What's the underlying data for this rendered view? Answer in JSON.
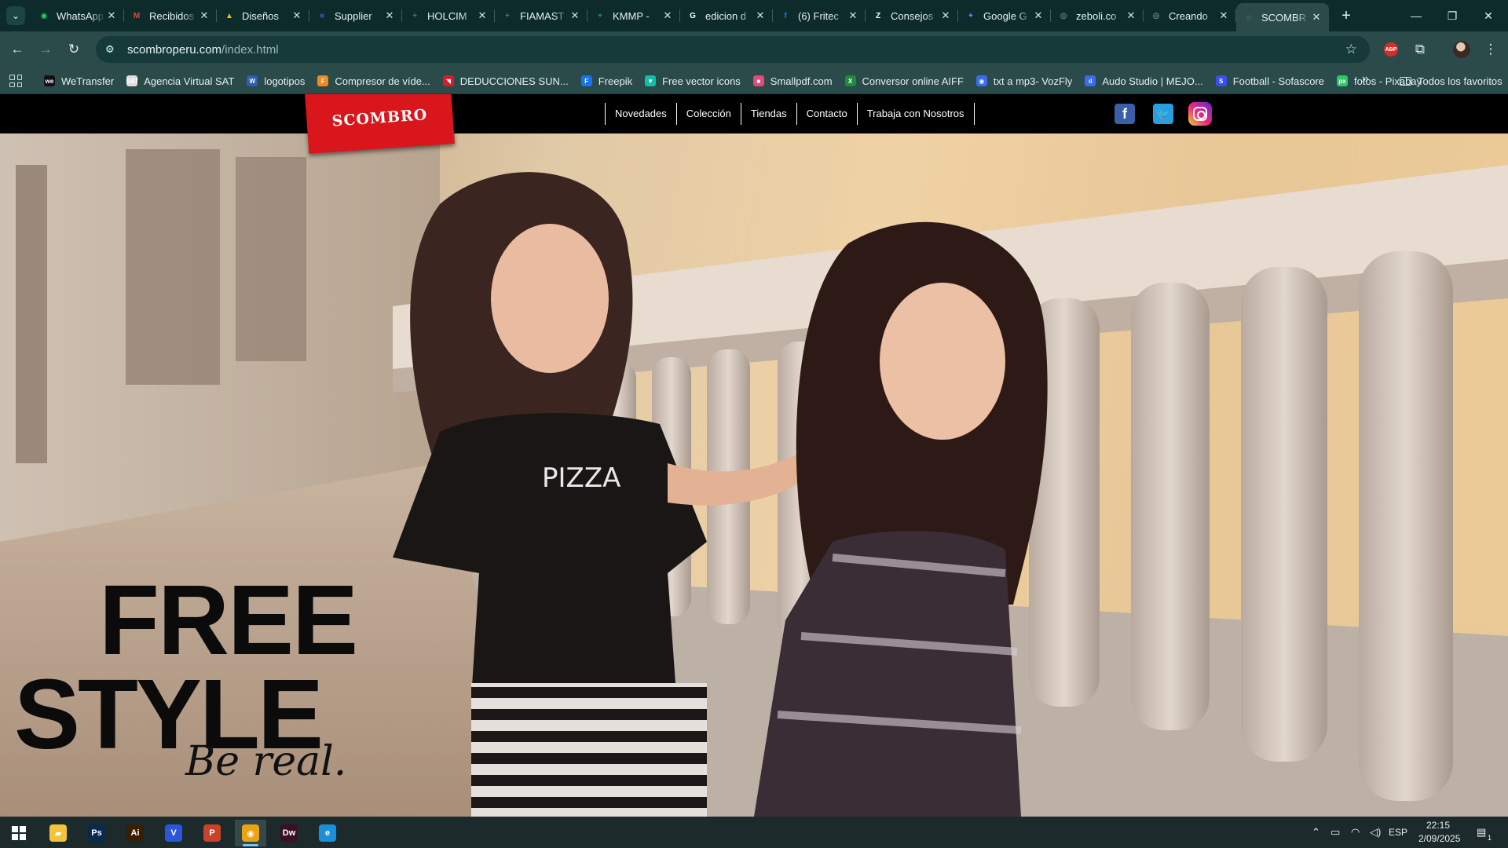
{
  "browser": {
    "tabs": [
      {
        "title": "WhatsApp",
        "icon": "whatsapp-icon",
        "color": "#25d366",
        "glyph": "◉"
      },
      {
        "title": "Recibidos",
        "icon": "gmail-icon",
        "color": "#ea4335",
        "glyph": "M"
      },
      {
        "title": "Diseños",
        "icon": "drive-icon",
        "color": "#fbbc04",
        "glyph": "▲"
      },
      {
        "title": "Supplier",
        "icon": "supplier-icon",
        "color": "#1f4fa8",
        "glyph": "■"
      },
      {
        "title": "HOLCIM",
        "icon": "sheets-icon",
        "color": "#0f9d58",
        "glyph": "+"
      },
      {
        "title": "FIAMAST",
        "icon": "sheets-icon",
        "color": "#0f9d58",
        "glyph": "+"
      },
      {
        "title": "KMMP -",
        "icon": "sheets-icon",
        "color": "#0f9d58",
        "glyph": "+"
      },
      {
        "title": "edicion d",
        "icon": "google-icon",
        "color": "#ffffff",
        "glyph": "G"
      },
      {
        "title": "(6) Fritec",
        "icon": "facebook-icon",
        "color": "#1877f2",
        "glyph": "f"
      },
      {
        "title": "Consejos",
        "icon": "z-icon",
        "color": "#ffffff",
        "glyph": "Z"
      },
      {
        "title": "Google G",
        "icon": "gemini-icon",
        "color": "#4a8cf7",
        "glyph": "✦"
      },
      {
        "title": "zeboli.co",
        "icon": "globe-icon",
        "color": "#9bb",
        "glyph": "◎"
      },
      {
        "title": "Creando",
        "icon": "globe-icon",
        "color": "#9bb",
        "glyph": "◎"
      },
      {
        "title": "SCOMBR",
        "icon": "loading-icon",
        "color": "#9bb",
        "glyph": "◌"
      }
    ],
    "url_domain": "scombroperu.com",
    "url_path": "/index.html",
    "bookmarks": [
      {
        "label": "WeTransfer",
        "icon": "wetransfer-icon",
        "color": "#111111",
        "glyph": "we"
      },
      {
        "label": "Agencia Virtual SAT",
        "icon": "sat-icon",
        "color": "#dddddd",
        "glyph": "SAT"
      },
      {
        "label": "logotipos",
        "icon": "word-icon",
        "color": "#2b5fb4",
        "glyph": "W"
      },
      {
        "label": "Compresor de víde...",
        "icon": "compressor-icon",
        "color": "#f08a24",
        "glyph": "F"
      },
      {
        "label": "DEDUCCIONES SUN...",
        "icon": "sunat-icon",
        "color": "#d41e2b",
        "glyph": "◥"
      },
      {
        "label": "Freepik",
        "icon": "freepik-icon",
        "color": "#1a73e8",
        "glyph": "F"
      },
      {
        "label": "Free vector icons",
        "icon": "flaticon-icon",
        "color": "#10bfa6",
        "glyph": "▼"
      },
      {
        "label": "Smallpdf.com",
        "icon": "smallpdf-icon",
        "color": "#e14b7a",
        "glyph": "■"
      },
      {
        "label": "Conversor online AIFF",
        "icon": "converter-icon",
        "color": "#1e8a3a",
        "glyph": "X"
      },
      {
        "label": "txt a mp3- VozFly",
        "icon": "vozfly-icon",
        "color": "#3b6cf0",
        "glyph": "◉"
      },
      {
        "label": "Audo Studio | MEJO...",
        "icon": "audio-icon",
        "color": "#3b6cf0",
        "glyph": "ıl"
      },
      {
        "label": "Football - Sofascore",
        "icon": "sofascore-icon",
        "color": "#3b4df0",
        "glyph": "S"
      },
      {
        "label": "fotos - Pixabay",
        "icon": "pixabay-icon",
        "color": "#2ec66a",
        "glyph": "px"
      }
    ],
    "all_bookmarks_label": "Todos los favoritos"
  },
  "site": {
    "brand": "SCOMBRO",
    "nav": [
      "Novedades",
      "Colección",
      "Tiendas",
      "Contacto",
      "Trabaja con Nosotros"
    ],
    "social": {
      "facebook": "f",
      "twitter": "🐦"
    },
    "headline_line1": "FREE",
    "headline_line2": "STYLE",
    "tagline": "Be real.",
    "accent_color": "#d8161b"
  },
  "taskbar": {
    "apps": [
      {
        "name": "file-explorer",
        "glyph": "▰",
        "color": "#f3c33b"
      },
      {
        "name": "photoshop",
        "glyph": "Ps",
        "color": "#0a2a4d"
      },
      {
        "name": "illustrator",
        "glyph": "Ai",
        "color": "#3a1e00"
      },
      {
        "name": "vpn",
        "glyph": "V",
        "color": "#2c55d8"
      },
      {
        "name": "powerpoint",
        "glyph": "P",
        "color": "#c9432a"
      },
      {
        "name": "chrome",
        "glyph": "◉",
        "color": "#e8a317"
      },
      {
        "name": "dreamweaver",
        "glyph": "Dw",
        "color": "#3b0f24"
      },
      {
        "name": "edge",
        "glyph": "e",
        "color": "#1c8fd8"
      }
    ],
    "language": "ESP",
    "time": "22:15",
    "date": "2/09/2025",
    "notification_count": "1"
  }
}
